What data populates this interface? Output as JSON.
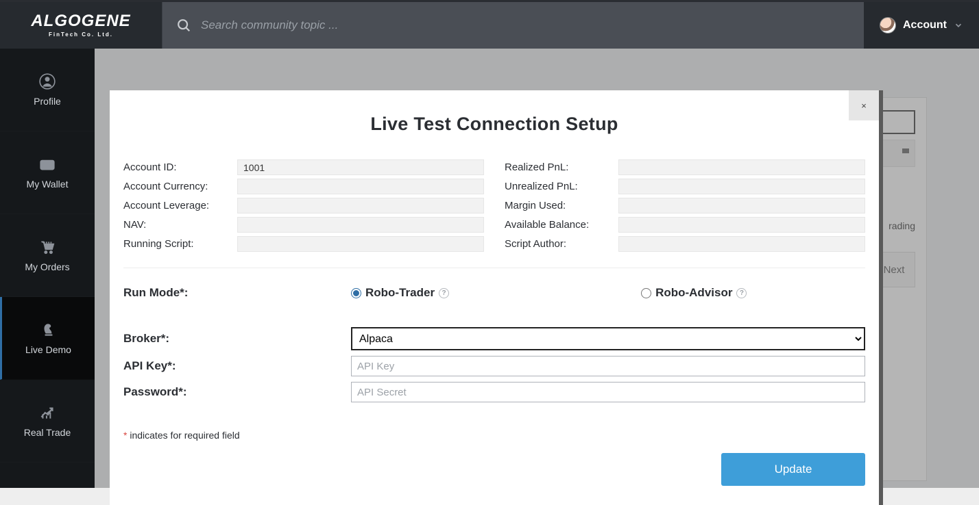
{
  "brand": {
    "name": "ALGOGENE",
    "tagline": "FinTech Co. Ltd."
  },
  "search": {
    "placeholder": "Search community topic ..."
  },
  "account": {
    "label": "Account"
  },
  "sidebar": {
    "items": [
      {
        "label": "Profile"
      },
      {
        "label": "My Wallet"
      },
      {
        "label": "My Orders"
      },
      {
        "label": "Live Demo"
      },
      {
        "label": "Real Trade"
      }
    ]
  },
  "backdrop": {
    "trading_fragment": "rading",
    "next_label": "Next"
  },
  "modal": {
    "close_glyph": "×",
    "title": "Live Test Connection Setup",
    "left_fields": {
      "account_id": {
        "label": "Account ID:",
        "value": "1001"
      },
      "account_currency": {
        "label": "Account Currency:",
        "value": ""
      },
      "account_leverage": {
        "label": "Account Leverage:",
        "value": ""
      },
      "nav": {
        "label": "NAV:",
        "value": ""
      },
      "running_script": {
        "label": "Running Script:",
        "value": ""
      }
    },
    "right_fields": {
      "realized_pnl": {
        "label": "Realized PnL:",
        "value": ""
      },
      "unrealized_pnl": {
        "label": "Unrealized PnL:",
        "value": ""
      },
      "margin_used": {
        "label": "Margin Used:",
        "value": ""
      },
      "available_balance": {
        "label": "Available Balance:",
        "value": ""
      },
      "script_author": {
        "label": "Script Author:",
        "value": ""
      }
    },
    "run_mode": {
      "label": "Run Mode*:",
      "options": [
        {
          "label": "Robo-Trader",
          "checked": true
        },
        {
          "label": "Robo-Advisor",
          "checked": false
        }
      ]
    },
    "broker": {
      "label": "Broker*:",
      "selected": "Alpaca"
    },
    "api_key": {
      "label": "API Key*:",
      "placeholder": "API Key"
    },
    "password": {
      "label": "Password*:",
      "placeholder": "API Secret"
    },
    "required_note": "indicates for required field",
    "star": "*",
    "update_label": "Update"
  }
}
